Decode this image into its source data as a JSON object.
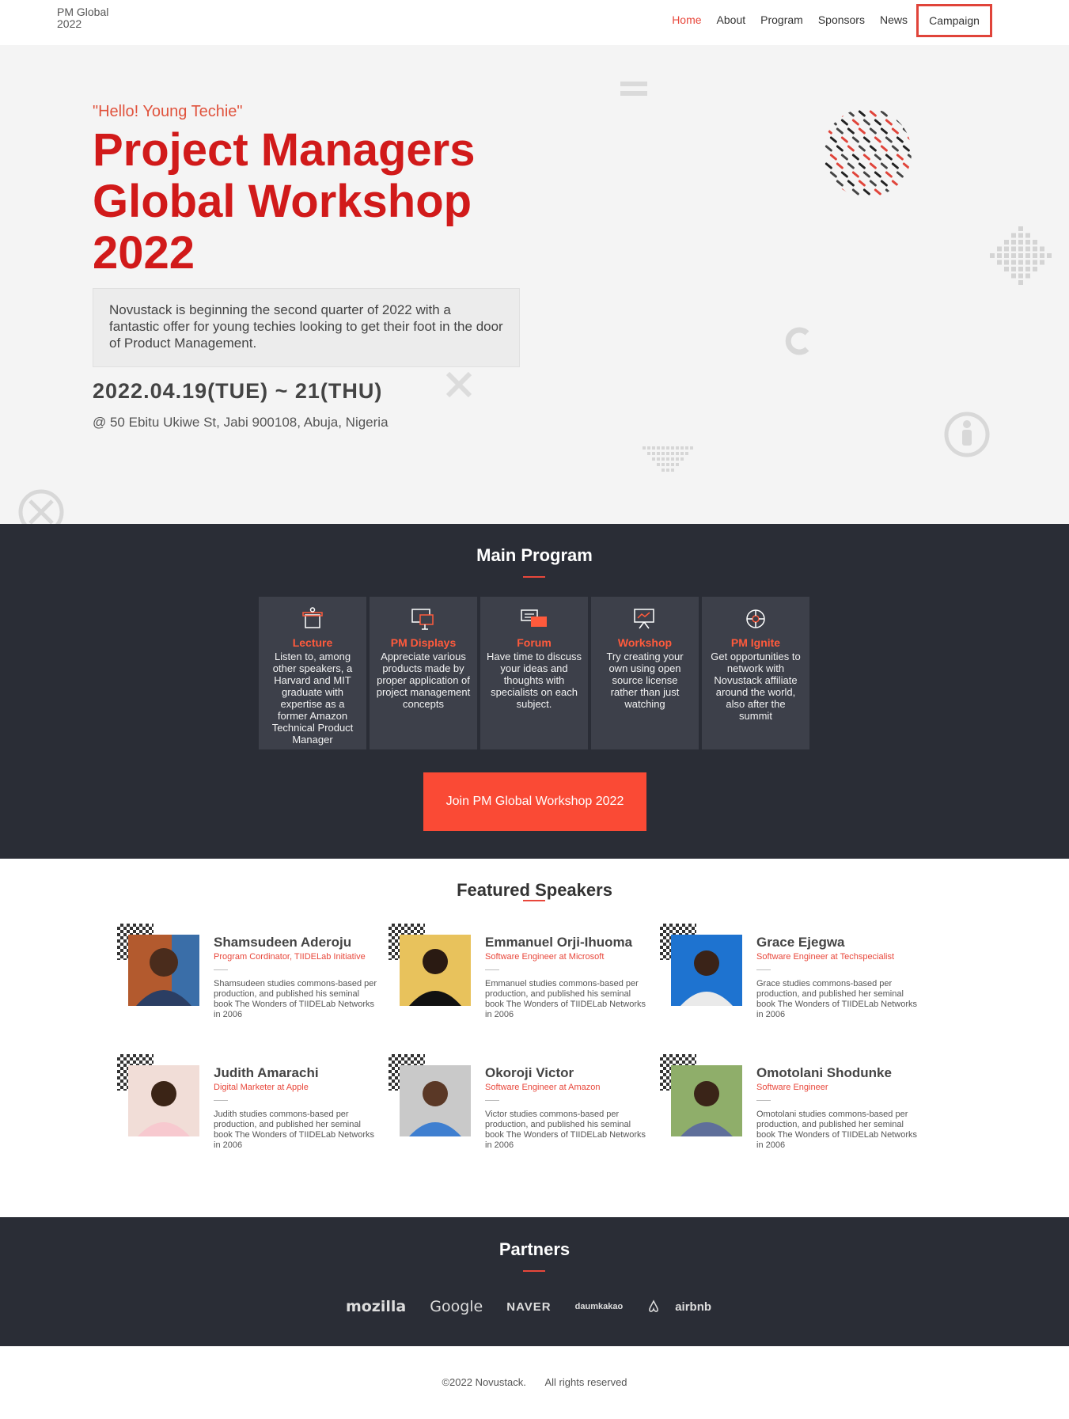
{
  "nav": {
    "brand": "PM Global 2022",
    "items": [
      {
        "label": "Home",
        "active": true
      },
      {
        "label": "About"
      },
      {
        "label": "Program"
      },
      {
        "label": "Sponsors"
      },
      {
        "label": "News"
      }
    ],
    "campaign": "Campaign"
  },
  "hero": {
    "tagline": "\"Hello! Young Techie\"",
    "title": "Project Managers Global Workshop 2022",
    "description": "Novustack is beginning the second quarter of 2022 with a fantastic offer for young techies looking to get their foot in the door of Product Management.",
    "date": "2022.04.19(TUE) ~ 21(THU)",
    "address": "@ 50 Ebitu Ukiwe St, Jabi 900108, Abuja, Nigeria"
  },
  "program": {
    "title": "Main Program",
    "cards": [
      {
        "title": "Lecture",
        "icon": "podium-icon",
        "text": "Listen to, among other speakers, a Harvard and MIT graduate with expertise as a former Amazon Technical Product Manager"
      },
      {
        "title": "PM Displays",
        "icon": "display-icon",
        "text": "Appreciate various products made by proper application of project management concepts"
      },
      {
        "title": "Forum",
        "icon": "chat-icon",
        "text": "Have time to discuss your ideas and thoughts with specialists on each subject."
      },
      {
        "title": "Workshop",
        "icon": "presentation-icon",
        "text": "Try creating your own using open source license rather than just watching"
      },
      {
        "title": "PM Ignite",
        "icon": "network-icon",
        "text": "Get opportunities to network with Novustack affiliate around the world, also after the summit"
      }
    ],
    "cta": "Join PM Global Workshop 2022"
  },
  "speakers": {
    "title": "Featured Speakers",
    "items": [
      {
        "name": "Shamsudeen Aderoju",
        "role": "Program Cordinator, TIIDELab Initiative",
        "bio": "Shamsudeen studies commons-based per production, and published his seminal book The Wonders of TIIDELab Networks in 2006"
      },
      {
        "name": "Emmanuel Orji-Ihuoma",
        "role": "Software Engineer at Microsoft",
        "bio": "Emmanuel studies commons-based per production, and published his seminal book The Wonders of TIIDELab Networks in 2006"
      },
      {
        "name": "Grace Ejegwa",
        "role": "Software Engineer at Techspecialist",
        "bio": "Grace studies commons-based per production, and published her seminal book The Wonders of TIIDELab Networks in 2006"
      },
      {
        "name": "Judith Amarachi",
        "role": "Digital Marketer at Apple",
        "bio": "Judith studies commons-based per production, and published her seminal book The Wonders of TIIDELab Networks in 2006"
      },
      {
        "name": "Okoroji Victor",
        "role": "Software Engineer at Amazon",
        "bio": "Victor studies commons-based per production, and published his seminal book The Wonders of TIIDELab Networks in 2006"
      },
      {
        "name": "Omotolani Shodunke",
        "role": "Software Engineer",
        "bio": "Omotolani studies commons-based per production, and published her seminal book The Wonders of TIIDELab Networks in 2006"
      }
    ]
  },
  "partners": {
    "title": "Partners",
    "logos": [
      "mozilla",
      "Google",
      "NAVER",
      "daumkakao",
      "airbnb"
    ]
  },
  "footer": {
    "copyright": "©2022 Novustack.",
    "rights": "All rights reserved"
  },
  "colors": {
    "accent": "#e8473b",
    "dark": "#2a2d36",
    "card": "#3d404a",
    "title": "#d11a1a"
  }
}
